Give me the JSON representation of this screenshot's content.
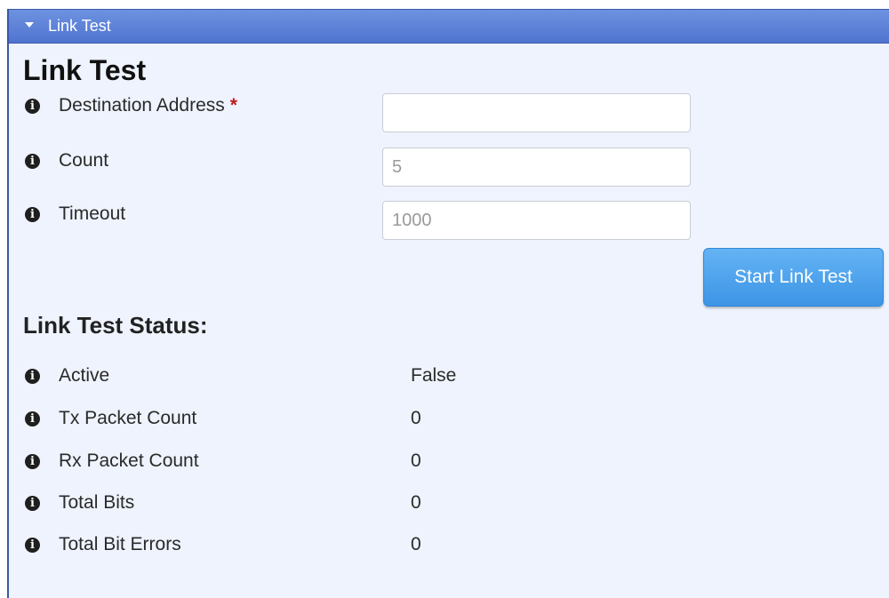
{
  "panel": {
    "header_title": "Link Test"
  },
  "page_title": "Link Test",
  "form": {
    "destination": {
      "label": "Destination Address",
      "required_mark": "*",
      "value": ""
    },
    "count": {
      "label": "Count",
      "placeholder": "5"
    },
    "timeout": {
      "label": "Timeout",
      "placeholder": "1000"
    },
    "start_button_label": "Start Link Test"
  },
  "status": {
    "title": "Link Test Status:",
    "rows": [
      {
        "label": "Active",
        "value": "False"
      },
      {
        "label": "Tx Packet Count",
        "value": "0"
      },
      {
        "label": "Rx Packet Count",
        "value": "0"
      },
      {
        "label": "Total Bits",
        "value": "0"
      },
      {
        "label": "Total Bit Errors",
        "value": "0"
      }
    ]
  },
  "icons": {
    "info": "info-icon",
    "collapse": "caret-down-icon"
  },
  "colors": {
    "header_bar": "#5a7fd6",
    "panel_background": "#eef3fd",
    "button": "#4a9fec",
    "required": "#c0191f"
  }
}
